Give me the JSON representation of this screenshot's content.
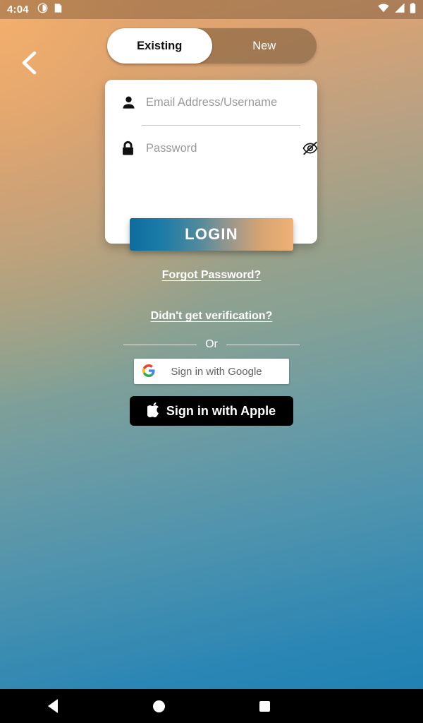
{
  "status_bar": {
    "time": "4:04",
    "left_icons": [
      "do-not-disturb-icon",
      "clipboard-icon"
    ],
    "right_icons": [
      "wifi-icon",
      "cellular-signal-icon",
      "battery-icon"
    ]
  },
  "nav": {
    "back_icon": "back-triangle-icon",
    "home_icon": "home-circle-icon",
    "recents_icon": "recents-square-icon"
  },
  "header": {
    "back_icon": "chevron-left-icon"
  },
  "tabs": [
    {
      "label": "Existing",
      "selected": true
    },
    {
      "label": "New",
      "selected": false
    }
  ],
  "form": {
    "username": {
      "icon": "person-icon",
      "value": "",
      "placeholder": "Email Address/Username"
    },
    "password": {
      "icon": "lock-icon",
      "value": "",
      "placeholder": "Password",
      "toggle_icon": "eye-off-icon"
    }
  },
  "actions": {
    "login_label": "LOGIN",
    "forgot_password_label": "Forgot Password?",
    "no_verification_label": "Didn't get verification?",
    "or_label": "Or",
    "google_label": "Sign in with Google",
    "google_icon": "google-g-icon",
    "apple_label": "Sign in with Apple",
    "apple_icon": "apple-logo-icon"
  },
  "colors": {
    "background_top": "#e9a96b",
    "background_bottom": "#1b7fb2",
    "login_gradient_start": "#0f6d9e",
    "login_gradient_end": "#efb176",
    "card_background": "#ffffff",
    "apple_button": "#000000",
    "placeholder_text": "#9a9a9a",
    "google_text": "#5f6368"
  }
}
